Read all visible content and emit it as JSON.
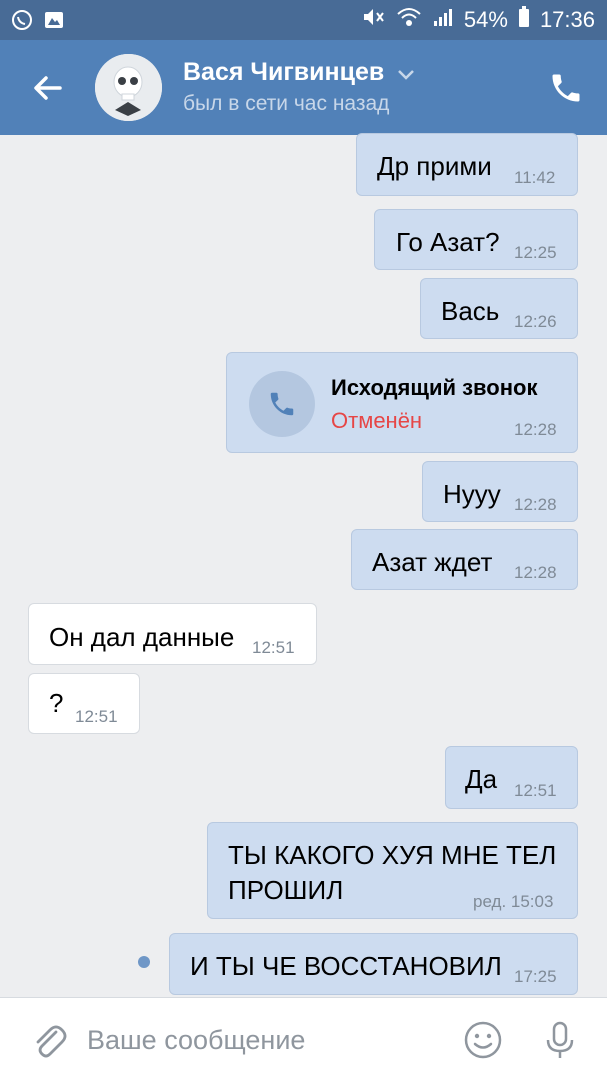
{
  "status_bar": {
    "battery": "54%",
    "time": "17:36"
  },
  "header": {
    "contact_name": "Вася Чигвинцев",
    "contact_status": "был в сети час назад"
  },
  "messages": [
    {
      "direction": "out",
      "text": "Др прими",
      "time": "11:42"
    },
    {
      "direction": "out",
      "text": "Го Азат?",
      "time": "12:25"
    },
    {
      "direction": "out",
      "text": "Вась",
      "time": "12:26"
    },
    {
      "direction": "out",
      "type": "call",
      "title": "Исходящий звонок",
      "call_status": "Отменён",
      "time": "12:28"
    },
    {
      "direction": "out",
      "text": "Нууу",
      "time": "12:28"
    },
    {
      "direction": "out",
      "text": "Азат ждет",
      "time": "12:28"
    },
    {
      "direction": "in",
      "text": "Он дал данные",
      "time": "12:51"
    },
    {
      "direction": "in",
      "text": "?",
      "time": "12:51"
    },
    {
      "direction": "out",
      "text": "Да",
      "time": "12:51"
    },
    {
      "direction": "out",
      "text_line1": "ТЫ КАКОГО ХУЯ МНЕ ТЕЛ",
      "text_line2": "ПРОШИЛ",
      "time": "ред. 15:03"
    },
    {
      "direction": "out",
      "text": "И ТЫ ЧЕ ВОССТАНОВИЛ",
      "time": "17:25"
    }
  ],
  "composer": {
    "placeholder": "Ваше сообщение"
  },
  "colors": {
    "status_bar": "#486b96",
    "header": "#5181b8",
    "outgoing_bubble": "#cddcf0",
    "incoming_bubble": "#ffffff",
    "background": "#edeef0",
    "cancelled_red": "#e64646"
  }
}
